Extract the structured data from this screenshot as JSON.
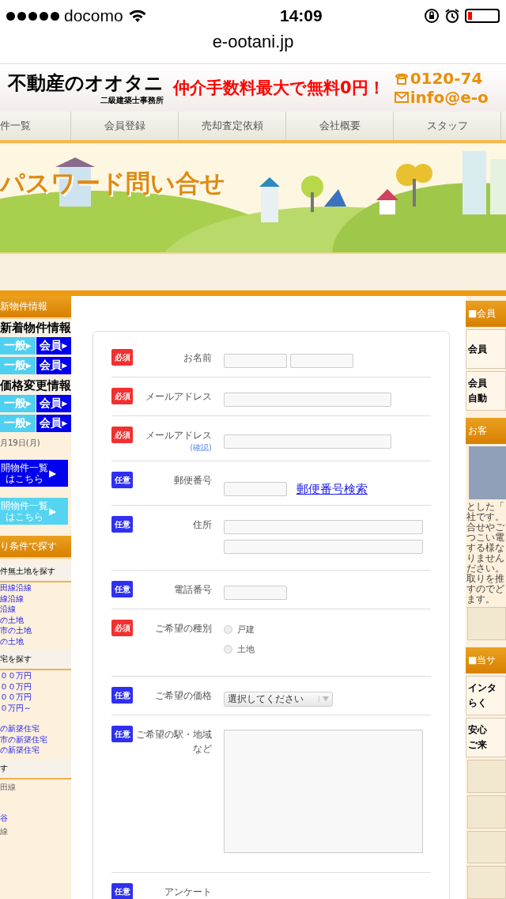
{
  "status_bar": {
    "carrier": "docomo",
    "time": "14:09"
  },
  "url": "e-ootani.jp",
  "header": {
    "logo": "不動産のオオタニ",
    "logo_sub": "二級建築士事務所",
    "slogan": "仲介手数料最大で無料0円！",
    "phone": "0120-74",
    "email": "info@e-o"
  },
  "nav": [
    "件一覧",
    "会員登録",
    "売却査定依頼",
    "会社概要",
    "スタッフ"
  ],
  "hero": {
    "title": "パスワード問い合せ"
  },
  "left": [
    {
      "kind": "header",
      "text": "新物件情報"
    },
    {
      "kind": "title",
      "text": "新着物件情報"
    },
    {
      "kind": "pair",
      "a": "一般▸",
      "b": "会員▸"
    },
    {
      "kind": "pair",
      "a": "一般▸",
      "b": "会員▸"
    },
    {
      "kind": "title",
      "text": "価格変更情報"
    },
    {
      "kind": "pair",
      "a": "一般▸",
      "b": "会員▸"
    },
    {
      "kind": "pair",
      "a": "一般▸",
      "b": "会員▸"
    },
    {
      "kind": "date",
      "text": "月19日(月)"
    },
    {
      "kind": "big",
      "text": "開物件一覧はこちら",
      "arrow": "▶",
      "color": "#0000ee"
    },
    {
      "kind": "big",
      "text": "開物件一覧はこちら",
      "arrow": "▶",
      "color": "#55d4f2"
    },
    {
      "kind": "header",
      "text": "り条件で探す"
    },
    {
      "kind": "sub",
      "text": "件無土地を探す"
    },
    {
      "kind": "link",
      "text": "田線沿線"
    },
    {
      "kind": "link",
      "text": "線沿線"
    },
    {
      "kind": "link",
      "text": "沿線"
    },
    {
      "kind": "link",
      "text": "の土地"
    },
    {
      "kind": "link",
      "text": "市の土地"
    },
    {
      "kind": "link",
      "text": "の土地"
    },
    {
      "kind": "sub",
      "text": "宅を探す"
    },
    {
      "kind": "link",
      "text": "００万円"
    },
    {
      "kind": "link",
      "text": "００万円"
    },
    {
      "kind": "link",
      "text": "００万円"
    },
    {
      "kind": "link",
      "text": "０万円～"
    },
    {
      "kind": "gap"
    },
    {
      "kind": "link",
      "text": "の新築住宅"
    },
    {
      "kind": "link",
      "text": "市の新築住宅"
    },
    {
      "kind": "link",
      "text": "の新築住宅"
    },
    {
      "kind": "sub",
      "text": "す"
    },
    {
      "kind": "plain",
      "text": "田線"
    },
    {
      "kind": "gap"
    },
    {
      "kind": "gap"
    },
    {
      "kind": "link",
      "text": "谷"
    },
    {
      "kind": "plain",
      "text": "線"
    }
  ],
  "right": [
    {
      "kind": "header",
      "text": "■会員"
    },
    {
      "kind": "banner",
      "lines": [
        "会員"
      ]
    },
    {
      "kind": "banner",
      "lines": [
        "会員",
        "自動"
      ]
    },
    {
      "kind": "header",
      "text": "お客"
    },
    {
      "kind": "photo"
    },
    {
      "kind": "text",
      "lines": [
        "とした「",
        "社です。",
        "合せやご",
        "つこい電",
        "する様な",
        "りません",
        "ださい。",
        "取りを推",
        "すのでど",
        "ます。"
      ]
    },
    {
      "kind": "picture"
    },
    {
      "kind": "header",
      "text": "■当サ"
    },
    {
      "kind": "banner",
      "lines": [
        "インタ",
        "らく"
      ]
    },
    {
      "kind": "banner",
      "lines": [
        "安心",
        "ご来"
      ]
    },
    {
      "kind": "picture"
    },
    {
      "kind": "picture"
    },
    {
      "kind": "picture"
    },
    {
      "kind": "picture"
    }
  ],
  "form": [
    {
      "badge_text": "必須",
      "color": "#f23030",
      "label": "お名前",
      "kind": "name"
    },
    {
      "badge_text": "必須",
      "color": "#f23030",
      "label": "メールアドレス",
      "kind": "text"
    },
    {
      "badge_text": "必須",
      "color": "#f23030",
      "label": "メールアドレス",
      "note": "(確認)",
      "kind": "text"
    },
    {
      "badge_text": "任意",
      "color": "#3030f0",
      "label": "郵便番号",
      "kind": "zip",
      "link": "郵便番号検索"
    },
    {
      "badge_text": "任意",
      "color": "#3030f0",
      "label": "住所",
      "kind": "address"
    },
    {
      "badge_text": "任意",
      "color": "#3030f0",
      "label": "電話番号",
      "kind": "short"
    },
    {
      "badge_text": "必須",
      "color": "#f23030",
      "label": "ご希望の種別",
      "kind": "radio",
      "options": [
        {
          "label": "戸建",
          "selected": false
        },
        {
          "label": "土地",
          "selected": false
        }
      ]
    },
    {
      "badge_text": "任意",
      "color": "#3030f0",
      "label": "ご希望の価格",
      "kind": "select",
      "value": "選択してください"
    },
    {
      "badge_text": "任意",
      "color": "#3030f0",
      "label": "ご希望の駅・地域など",
      "kind": "textarea"
    },
    {
      "badge_text": "任意",
      "color": "#3030f0",
      "label": "アンケート",
      "kind": "none"
    }
  ]
}
